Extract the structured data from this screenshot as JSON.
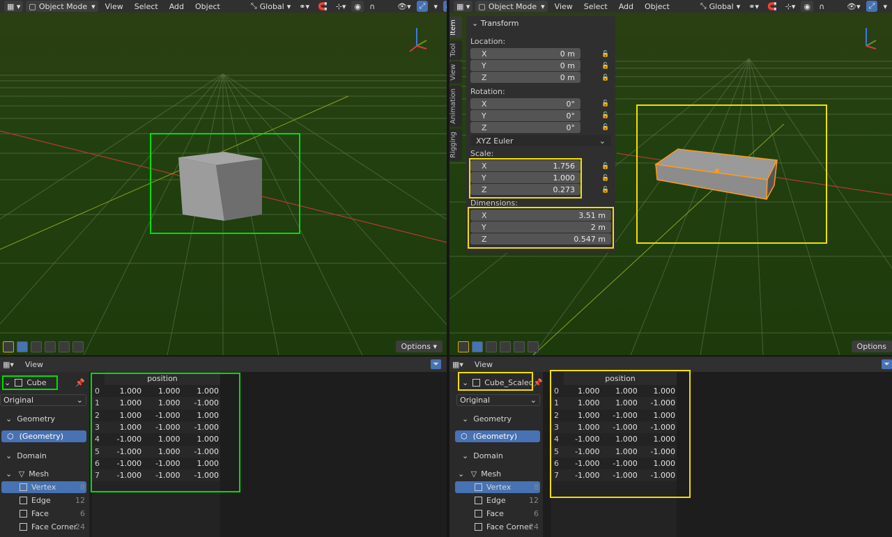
{
  "header": {
    "mode": "Object Mode",
    "menus": [
      "View",
      "Select",
      "Add",
      "Object"
    ],
    "transform_orientation": "Global"
  },
  "left_viewport": {
    "options_label": "Options"
  },
  "right_viewport": {
    "options_label": "Options",
    "npanel": {
      "tabs": [
        "Item",
        "Tool",
        "View",
        "Animation",
        "Rigging"
      ],
      "section": "Transform",
      "location_label": "Location:",
      "location": [
        {
          "axis": "X",
          "value": "0 m"
        },
        {
          "axis": "Y",
          "value": "0 m"
        },
        {
          "axis": "Z",
          "value": "0 m"
        }
      ],
      "rotation_label": "Rotation:",
      "rotation": [
        {
          "axis": "X",
          "value": "0°"
        },
        {
          "axis": "Y",
          "value": "0°"
        },
        {
          "axis": "Z",
          "value": "0°"
        }
      ],
      "rotation_mode": "XYZ Euler",
      "scale_label": "Scale:",
      "scale": [
        {
          "axis": "X",
          "value": "1.756"
        },
        {
          "axis": "Y",
          "value": "1.000"
        },
        {
          "axis": "Z",
          "value": "0.273"
        }
      ],
      "dimensions_label": "Dimensions:",
      "dimensions": [
        {
          "axis": "X",
          "value": "3.51 m"
        },
        {
          "axis": "Y",
          "value": "2 m"
        },
        {
          "axis": "Z",
          "value": "0.547 m"
        }
      ]
    }
  },
  "left_sheet": {
    "view_label": "View",
    "object_name": "Cube",
    "evaluation": "Original",
    "geometry_label": "Geometry",
    "geometry_item": "(Geometry)",
    "domain_label": "Domain",
    "mesh_label": "Mesh",
    "domains": [
      {
        "name": "Vertex",
        "count": "8"
      },
      {
        "name": "Edge",
        "count": "12"
      },
      {
        "name": "Face",
        "count": "6"
      },
      {
        "name": "Face Corner",
        "count": "24"
      }
    ],
    "column": "position",
    "rows": [
      [
        "0",
        "1.000",
        "1.000",
        "1.000"
      ],
      [
        "1",
        "1.000",
        "1.000",
        "-1.000"
      ],
      [
        "2",
        "1.000",
        "-1.000",
        "1.000"
      ],
      [
        "3",
        "1.000",
        "-1.000",
        "-1.000"
      ],
      [
        "4",
        "-1.000",
        "1.000",
        "1.000"
      ],
      [
        "5",
        "-1.000",
        "1.000",
        "-1.000"
      ],
      [
        "6",
        "-1.000",
        "-1.000",
        "1.000"
      ],
      [
        "7",
        "-1.000",
        "-1.000",
        "-1.000"
      ]
    ]
  },
  "right_sheet": {
    "view_label": "View",
    "object_name": "Cube_Scaled",
    "evaluation": "Original",
    "geometry_label": "Geometry",
    "geometry_item": "(Geometry)",
    "domain_label": "Domain",
    "mesh_label": "Mesh",
    "domains": [
      {
        "name": "Vertex",
        "count": "8"
      },
      {
        "name": "Edge",
        "count": "12"
      },
      {
        "name": "Face",
        "count": "6"
      },
      {
        "name": "Face Corner",
        "count": "24"
      }
    ],
    "column": "position",
    "rows": [
      [
        "0",
        "1.000",
        "1.000",
        "1.000"
      ],
      [
        "1",
        "1.000",
        "1.000",
        "-1.000"
      ],
      [
        "2",
        "1.000",
        "-1.000",
        "1.000"
      ],
      [
        "3",
        "1.000",
        "-1.000",
        "-1.000"
      ],
      [
        "4",
        "-1.000",
        "1.000",
        "1.000"
      ],
      [
        "5",
        "-1.000",
        "1.000",
        "-1.000"
      ],
      [
        "6",
        "-1.000",
        "-1.000",
        "1.000"
      ],
      [
        "7",
        "-1.000",
        "-1.000",
        "-1.000"
      ]
    ]
  },
  "colors": {
    "highlight_left": "#00e000",
    "highlight_right": "#f0e000",
    "selection_accent": "#4772b3",
    "active_object_outline": "#ff9a1a"
  }
}
